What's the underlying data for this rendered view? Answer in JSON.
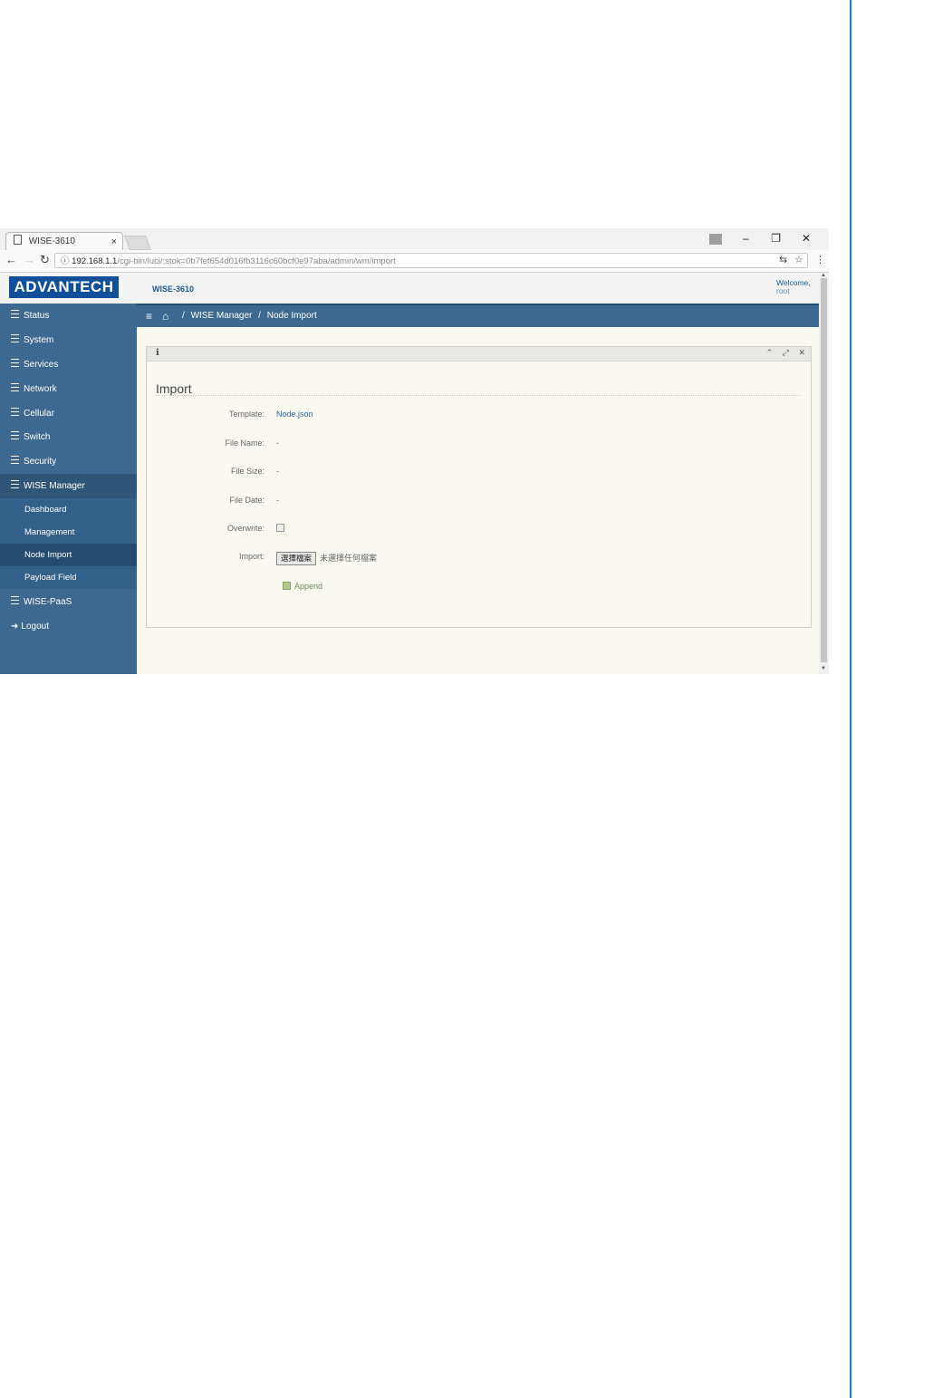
{
  "browser": {
    "tab_title": "WISE-3610",
    "tab_close": "×",
    "url_host": "192.168.1.1",
    "url_path": "/cgi-bin/luci/;stok=0b7fef654d016fb3116c60bcf0e97aba/admin/wm/import",
    "window_controls": [
      "–",
      "❐",
      "✕"
    ]
  },
  "header": {
    "logo_text": "ADVANTECH",
    "device": "WISE-3610",
    "welcome": "Welcome,",
    "user": "root"
  },
  "sidebar": {
    "items": [
      {
        "label": "Status"
      },
      {
        "label": "System"
      },
      {
        "label": "Services"
      },
      {
        "label": "Network"
      },
      {
        "label": "Cellular"
      },
      {
        "label": "Switch"
      },
      {
        "label": "Security"
      },
      {
        "label": "WISE Manager"
      }
    ],
    "subitems": [
      {
        "label": "Dashboard"
      },
      {
        "label": "Management"
      },
      {
        "label": "Node Import"
      },
      {
        "label": "Payload Field"
      }
    ],
    "after": [
      {
        "label": "WISE-PaaS"
      },
      {
        "label": "Logout"
      }
    ]
  },
  "breadcrumb": {
    "parent": "WISE Manager",
    "sep": "/",
    "current": "Node Import"
  },
  "form": {
    "section_title": "Import",
    "template_label": "Template:",
    "template_value": "Node.json",
    "filename_label": "File Name:",
    "filename_value": "-",
    "filesize_label": "File Size:",
    "filesize_value": "-",
    "filedate_label": "File Date:",
    "filedate_value": "-",
    "overwrite_label": "Overwrite:",
    "import_label": "Import:",
    "file_button": "選擇檔案",
    "file_state": "未選擇任何檔案",
    "append_label": "Append"
  },
  "colors": {
    "sidebar_bg": "#3d6990",
    "header_border": "#2a4d6e",
    "content_bg": "#fbfaf0",
    "logo_bg": "#114f9a"
  }
}
